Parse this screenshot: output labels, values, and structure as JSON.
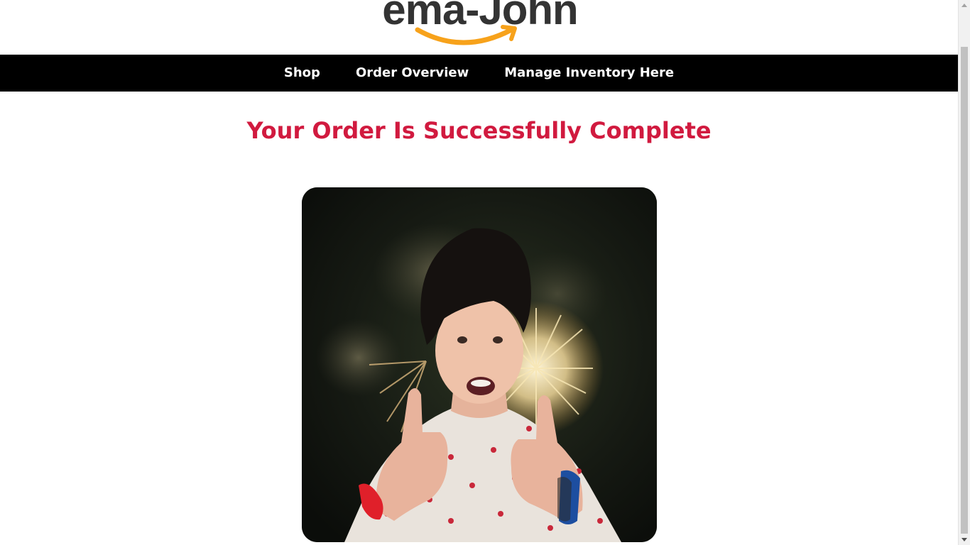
{
  "app": {
    "logo_text": "ema-John"
  },
  "nav": {
    "items": [
      {
        "label": "Shop"
      },
      {
        "label": "Order Overview"
      },
      {
        "label": "Manage Inventory Here"
      }
    ]
  },
  "main": {
    "heading": "Your Order Is Successfully Complete",
    "image": {
      "description_icon": "celebration-image"
    }
  },
  "colors": {
    "heading": "#d11a3f",
    "nav_background": "#000000",
    "nav_text": "#ffffff",
    "logo_text": "#333333",
    "logo_smile": "#f7a21b"
  }
}
